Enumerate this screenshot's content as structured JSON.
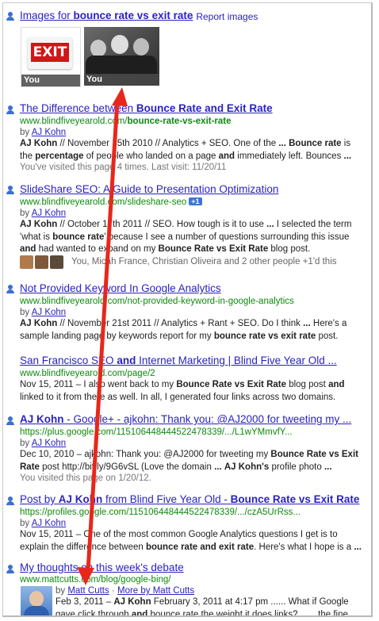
{
  "images_header": {
    "title_pre": "Images for ",
    "title_bold": "bounce rate vs exit rate",
    "separator": " - ",
    "report": "Report images"
  },
  "image_thumbs": [
    {
      "label": "You",
      "icon": "exit-sign-icon",
      "sign_text": "EXIT"
    },
    {
      "label": "You",
      "icon": "group-photo"
    }
  ],
  "results": [
    {
      "title_pre": "The Difference between ",
      "title_bold": "Bounce Rate and Exit Rate",
      "url_pre": "www.blindfiveyearold.com/",
      "url_bold": "bounce-rate-vs-exit-rate",
      "by_pre": "by ",
      "author": "AJ Kohn",
      "snippet": [
        {
          "t": "AJ Kohn",
          "b": true
        },
        {
          "t": " // November 15th 2010 // Analytics + SEO. One of the ",
          "b": false
        },
        {
          "t": "...",
          "b": true
        },
        {
          "t": " ",
          "b": false
        },
        {
          "t": "Bounce rate",
          "b": true
        },
        {
          "t": " is the ",
          "b": false
        },
        {
          "t": "percentage",
          "b": true
        },
        {
          "t": " of people who landed on a page ",
          "b": false
        },
        {
          "t": "and",
          "b": true
        },
        {
          "t": " immediately left. Bounces ",
          "b": false
        },
        {
          "t": "...",
          "b": true
        }
      ],
      "visited": "You've visited this page 4 times. Last visit: 11/20/11"
    },
    {
      "title_pre": "SlideShare SEO: A Guide to Presentation Optimization",
      "url_pre": "www.blindfiveyearold.com/slideshare-seo",
      "plusone": "+1",
      "by_pre": "by ",
      "author": "AJ Kohn",
      "snippet": [
        {
          "t": "AJ Kohn",
          "b": true
        },
        {
          "t": " // October 17th 2011 // SEO. How tough is it to use ",
          "b": false
        },
        {
          "t": "...",
          "b": true
        },
        {
          "t": " I selected the term 'what is ",
          "b": false
        },
        {
          "t": "bounce rate",
          "b": true
        },
        {
          "t": "' because I see a number of questions surrounding this issue ",
          "b": false
        },
        {
          "t": "and",
          "b": true
        },
        {
          "t": " had wanted to expand on my ",
          "b": false
        },
        {
          "t": "Bounce Rate vs Exit Rate",
          "b": true
        },
        {
          "t": " blog post.",
          "b": false
        }
      ],
      "social": "You, Micah France, Christian Oliveira and 2 other people +1'd this"
    },
    {
      "title_pre": "Not Provided Keyword In Google Analytics",
      "url_pre": "www.blindfiveyearold.com/not-provided-keyword-in-google-analytics",
      "by_pre": "by ",
      "author": "AJ Kohn",
      "snippet": [
        {
          "t": "AJ Kohn",
          "b": true
        },
        {
          "t": " // November 21st 2011 // Analytics + Rant + SEO. Do I think ",
          "b": false
        },
        {
          "t": "...",
          "b": true
        },
        {
          "t": " Here's a sample landing page by keywords report for my ",
          "b": false
        },
        {
          "t": "bounce rate vs exit rate",
          "b": true
        },
        {
          "t": " post.",
          "b": false
        }
      ]
    },
    {
      "title_pre": "San Francisco SEO ",
      "title_bold": "and",
      "title_post": " Internet Marketing | Blind Five Year Old ...",
      "url_pre": "www.blindfiveyearold.com/page/2",
      "snippet": [
        {
          "t": "Nov 15, 2011 – I also went back to my ",
          "b": false
        },
        {
          "t": "Bounce Rate vs Exit Rate",
          "b": true
        },
        {
          "t": " blog post ",
          "b": false
        },
        {
          "t": "and",
          "b": true
        },
        {
          "t": " linked to it from there as well. In all, I generated four links across two domains.",
          "b": false
        }
      ]
    },
    {
      "title_pre_bold": "AJ Kohn",
      "title_pre": " - Google+ - ajkohn: Thank you: @AJ2000 for tweeting my ...",
      "url_pre": "https://plus.google.com/115106448444522478339/.../L1wYMmvfY...",
      "by_pre": "by ",
      "author": "AJ Kohn",
      "snippet": [
        {
          "t": "Dec 10, 2010 – ajkohn: Thank you: @AJ2000 for tweeting my ",
          "b": false
        },
        {
          "t": "Bounce Rate vs Exit Rate",
          "b": true
        },
        {
          "t": " post http://bit.ly/9G6vSL (Love the domain ",
          "b": false
        },
        {
          "t": "...",
          "b": true
        },
        {
          "t": " ",
          "b": false
        },
        {
          "t": "AJ Kohn's",
          "b": true
        },
        {
          "t": " profile photo ",
          "b": false
        },
        {
          "t": "...",
          "b": true
        }
      ],
      "visited": "You visited this page on 1/20/12."
    },
    {
      "title_pre": "Post by ",
      "title_bold": "AJ Kohn",
      "title_post": " from Blind Five Year Old - ",
      "title_bold2": "Bounce Rate vs Exit Rate",
      "url_pre": "https://profiles.google.com/115106448444522478339/.../czA5UrRss...",
      "by_pre": "by ",
      "author": "AJ Kohn",
      "snippet": [
        {
          "t": "Nov 15, 2011 – One of the most common Google Analytics questions I get is to explain the difference between ",
          "b": false
        },
        {
          "t": "bounce rate and exit rate",
          "b": true
        },
        {
          "t": ". Here's what I hope is a ",
          "b": false
        },
        {
          "t": "...",
          "b": true
        }
      ]
    },
    {
      "title_pre": "My thoughts on this week's debate",
      "url_pre": "www.mattcutts.com/blog/google-bing/",
      "by_pre": "by ",
      "author": "Matt Cutts",
      "more_sep": " · ",
      "more": "More by Matt Cutts",
      "snippet": [
        {
          "t": "Feb 3, 2011 – ",
          "b": false
        },
        {
          "t": "AJ Kohn",
          "b": true
        },
        {
          "t": " February 3, 2011 at 4:17 pm ...... What if Google gave click through ",
          "b": false
        },
        {
          "t": "and",
          "b": true
        },
        {
          "t": " bounce rate the weight it does links? ...... the fine print – it will",
          "b": false
        }
      ]
    }
  ],
  "colors": {
    "link": "#2a22c0",
    "url": "#0d8a0d",
    "arrow": "#e8271c",
    "person": "#3a6fd4"
  }
}
